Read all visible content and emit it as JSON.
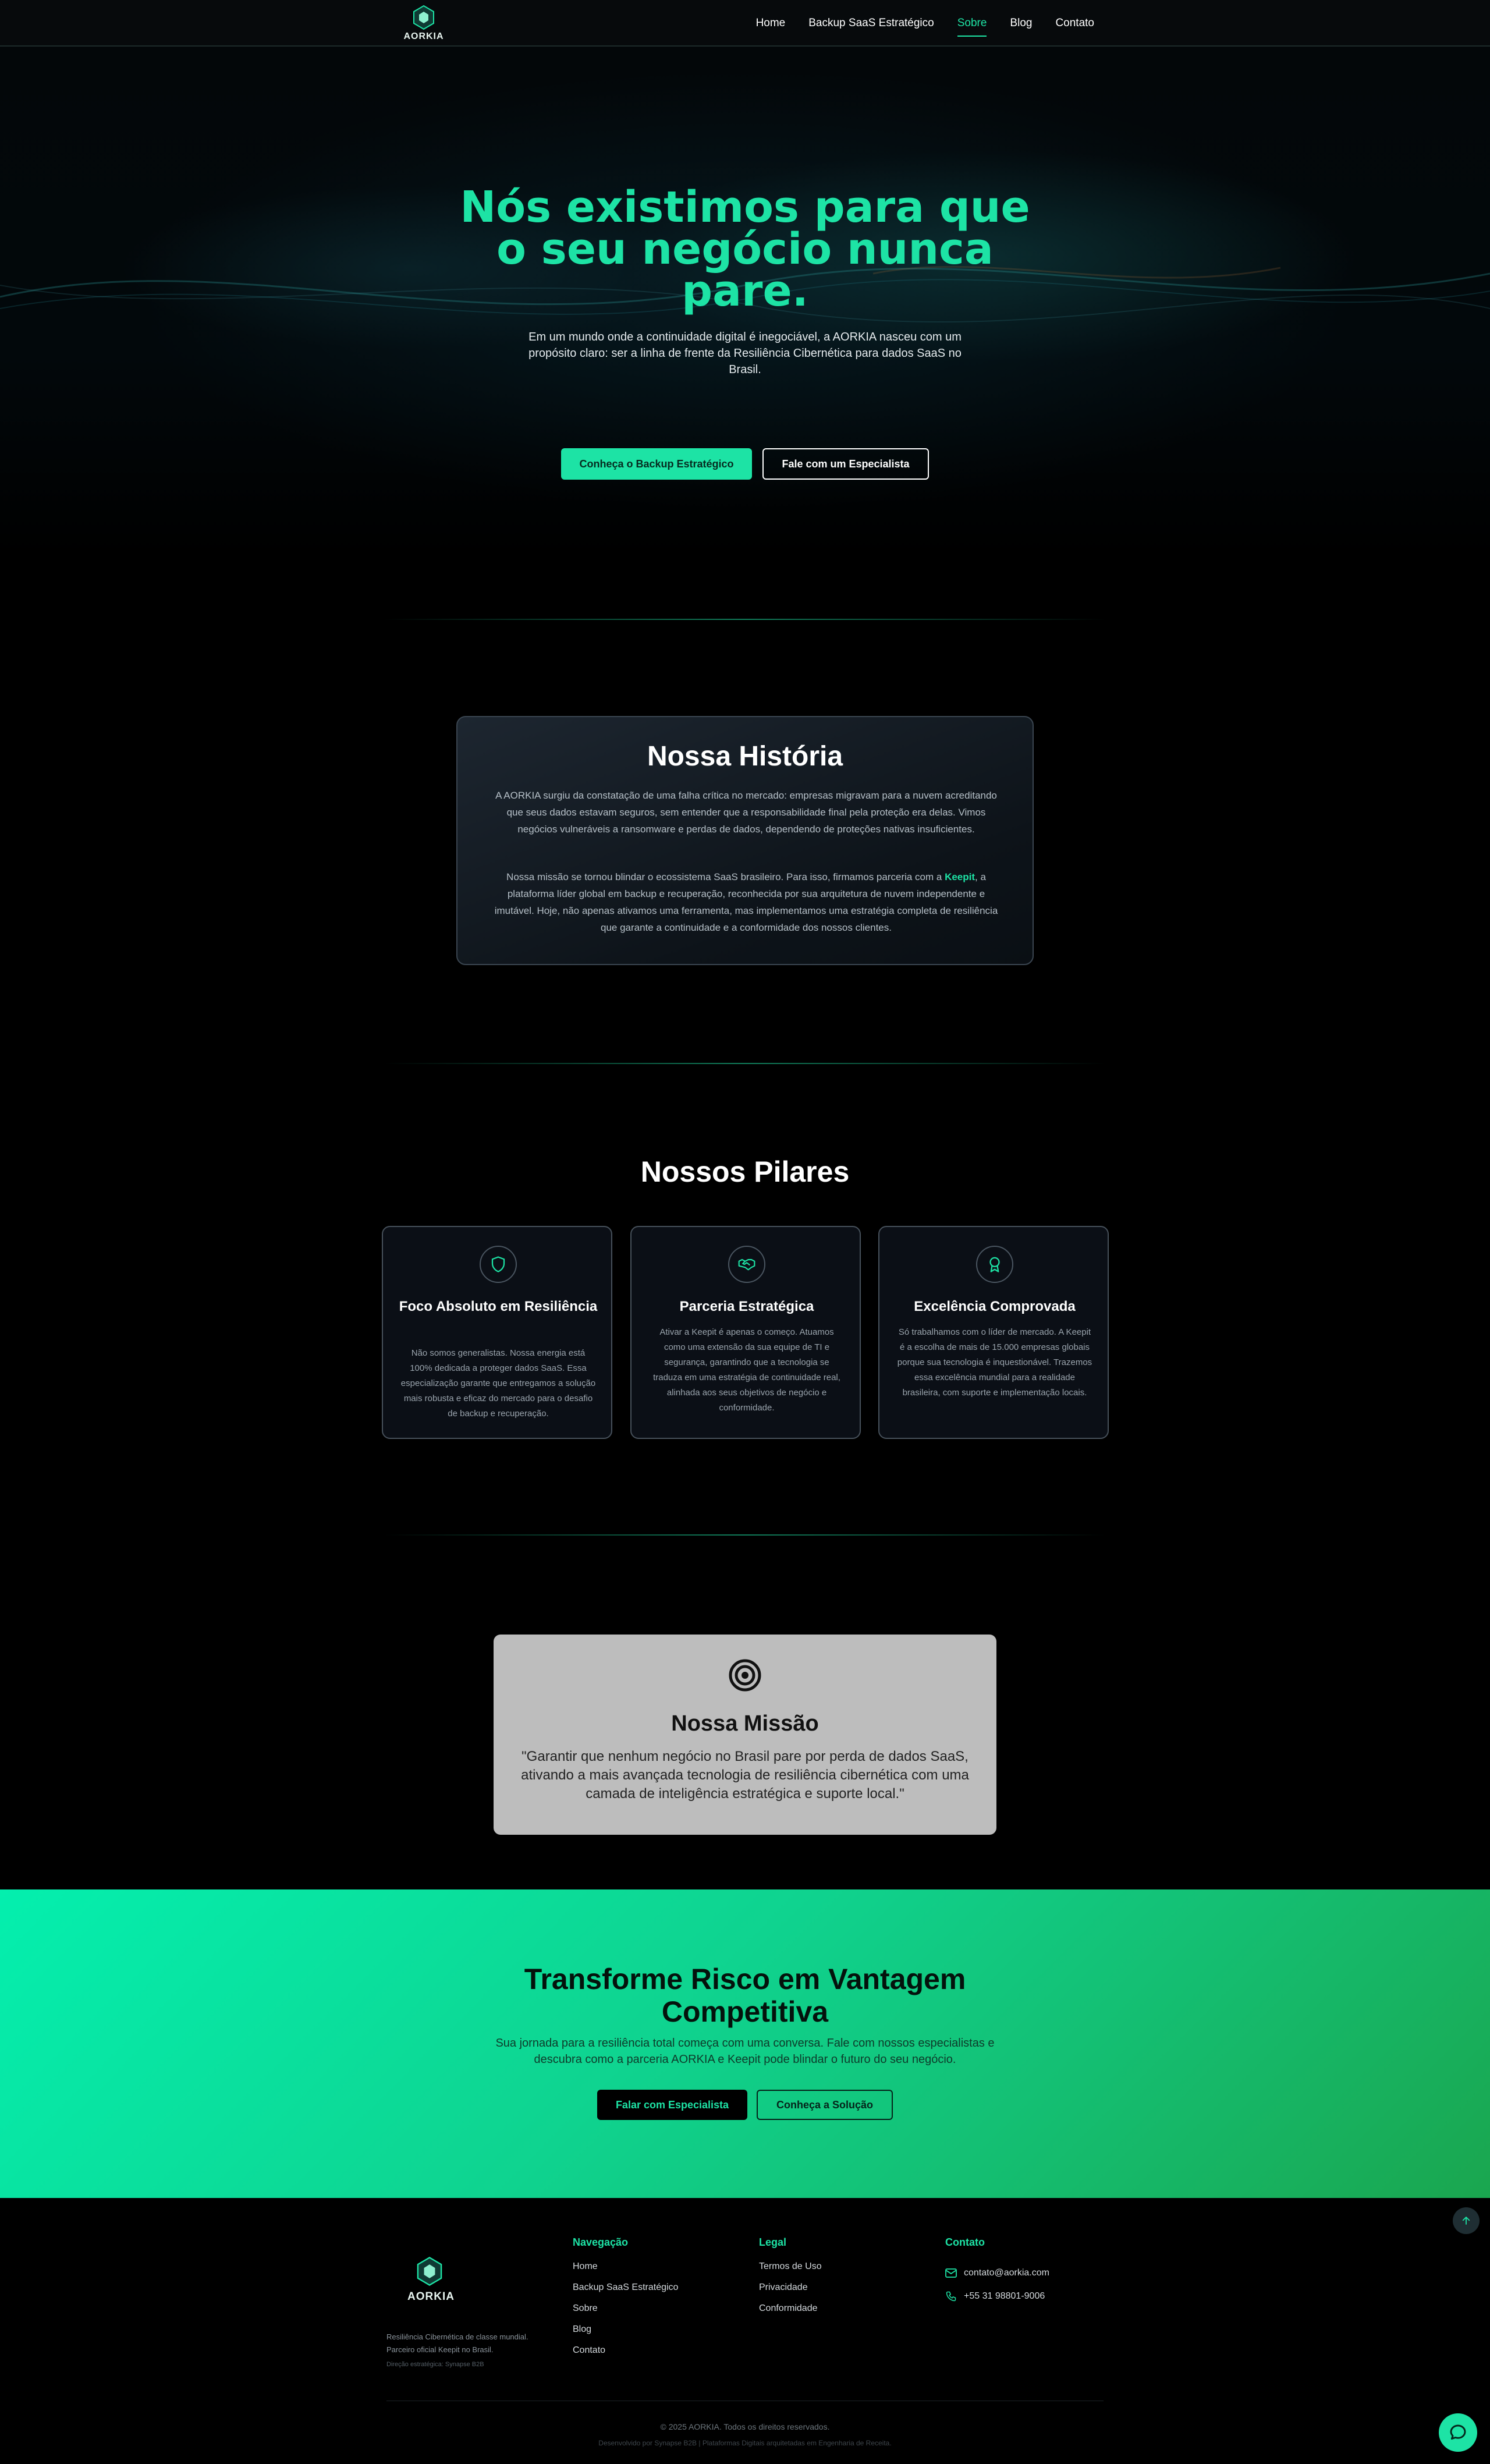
{
  "brand": {
    "name": "AORKIA",
    "accent": "#1de3a5"
  },
  "nav": {
    "items": [
      {
        "label": "Home"
      },
      {
        "label": "Backup SaaS Estratégico"
      },
      {
        "label": "Sobre",
        "active": true
      },
      {
        "label": "Blog"
      },
      {
        "label": "Contato"
      }
    ]
  },
  "hero": {
    "title": "Nós existimos para que o seu negócio nunca pare.",
    "subtitle": "Em um mundo onde a continuidade digital é inegociável, a AORKIA nasceu com um propósito claro: ser a linha de frente da Resiliência Cibernética para dados SaaS no Brasil.",
    "primary_button": "Conheça o Backup Estratégico",
    "secondary_button": "Fale com um Especialista"
  },
  "history": {
    "title": "Nossa História",
    "paragraph1": "A AORKIA surgiu da constatação de uma falha crítica no mercado: empresas migravam para a nuvem acreditando que seus dados estavam seguros, sem entender que a responsabilidade final pela proteção era delas. Vimos negócios vulneráveis a ransomware e perdas de dados, dependendo de proteções nativas insuficientes.",
    "paragraph2_before": "Nossa missão se tornou blindar o ecossistema SaaS brasileiro. Para isso, firmamos parceria com a ",
    "paragraph2_highlight": "Keepit",
    "paragraph2_after": ", a plataforma líder global em backup e recuperação, reconhecida por sua arquitetura de nuvem independente e imutável. Hoje, não apenas ativamos uma ferramenta, mas implementamos uma estratégia completa de resiliência que garante a continuidade e a conformidade dos nossos clientes."
  },
  "pillars": {
    "title": "Nossos Pilares",
    "items": [
      {
        "icon": "shield-icon",
        "title": "Foco Absoluto em Resiliência",
        "text": "Não somos generalistas. Nossa energia está 100% dedicada a proteger dados SaaS. Essa especialização garante que entregamos a solução mais robusta e eficaz do mercado para o desafio de backup e recuperação."
      },
      {
        "icon": "handshake-icon",
        "title": "Parceria Estratégica",
        "text": "Ativar a Keepit é apenas o começo. Atuamos como uma extensão da sua equipe de TI e segurança, garantindo que a tecnologia se traduza em uma estratégia de continuidade real, alinhada aos seus objetivos de negócio e conformidade."
      },
      {
        "icon": "award-icon",
        "title": "Excelência Comprovada",
        "text": "Só trabalhamos com o líder de mercado. A Keepit é a escolha de mais de 15.000 empresas globais porque sua tecnologia é inquestionável. Trazemos essa excelência mundial para a realidade brasileira, com suporte e implementação locais."
      }
    ]
  },
  "mission": {
    "title": "Nossa Missão",
    "quote": "\"Garantir que nenhum negócio no Brasil pare por perda de dados SaaS, ativando a mais avançada tecnologia de resiliência cibernética com uma camada de inteligência estratégica e suporte local.\""
  },
  "cta": {
    "title": "Transforme Risco em Vantagem Competitiva",
    "text": "Sua jornada para a resiliência total começa com uma conversa. Fale com nossos especialistas e descubra como a parceria AORKIA e Keepit pode blindar o futuro do seu negócio.",
    "primary_button": "Falar com Especialista",
    "secondary_button": "Conheça a Solução"
  },
  "footer": {
    "tagline_line1": "Resiliência Cibernética de classe mundial.",
    "tagline_line2": "Parceiro oficial Keepit no Brasil.",
    "agency": "Direção estratégica: Synapse B2B",
    "nav_title": "Navegação",
    "nav_items": [
      "Home",
      "Backup SaaS Estratégico",
      "Sobre",
      "Blog",
      "Contato"
    ],
    "legal_title": "Legal",
    "legal_items": [
      "Termos de Uso",
      "Privacidade",
      "Conformidade"
    ],
    "contact_title": "Contato",
    "email": "contato@aorkia.com",
    "phone": "+55 31 98801-9006",
    "copyright": "© 2025 AORKIA. Todos os direitos reservados.",
    "developed_by": "Desenvolvido por Synapse B2B | Plataformas Digitais arquitetadas em Engenharia de Receita."
  }
}
